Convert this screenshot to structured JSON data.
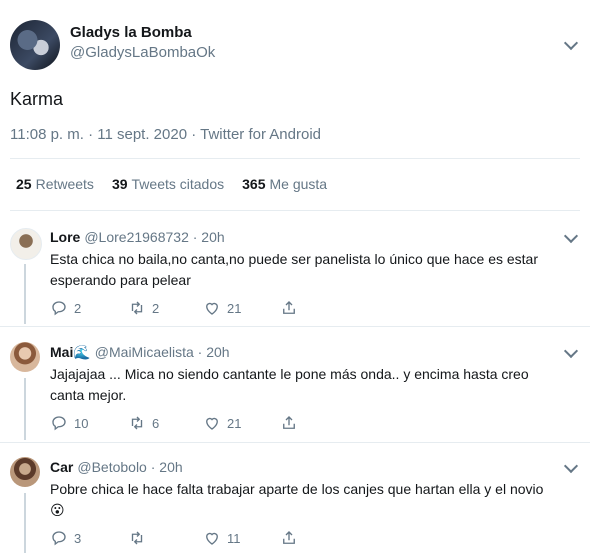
{
  "main_tweet": {
    "author_name": "Gladys la Bomba",
    "author_handle": "@GladysLaBombaOk",
    "text": "Karma",
    "meta": "11:08 p. m. · 11 sept. 2020 · Twitter for Android",
    "stats": [
      {
        "count": "25",
        "label": "Retweets"
      },
      {
        "count": "39",
        "label": "Tweets citados"
      },
      {
        "count": "365",
        "label": "Me gusta"
      }
    ]
  },
  "replies": [
    {
      "name": "Lore",
      "handle": "@Lore21968732 · 20h",
      "text_lines": [
        "Esta chica no baila,no canta,no puede ser panelista lo único que hace es estar",
        "esperando para pelear"
      ],
      "replies": "2",
      "retweets": "2",
      "likes": "21"
    },
    {
      "name": "Mai🌊",
      "handle": "@MaiMicaelista · 20h",
      "text_lines": [
        "Jajajajaa ... Mica no siendo cantante le pone más onda.. y encima hasta creo",
        "canta mejor."
      ],
      "replies": "10",
      "retweets": "6",
      "likes": "21"
    },
    {
      "name": "Car",
      "handle": "@Betobolo · 20h",
      "text_lines": [
        "Pobre chica le hace falta trabajar aparte de los canjes que hartan ella y el novio",
        "😮"
      ],
      "replies": "3",
      "retweets": "",
      "likes": "11"
    }
  ],
  "colors": {
    "text": "#14171a",
    "secondary": "#657786",
    "border": "#e6ecf0"
  }
}
